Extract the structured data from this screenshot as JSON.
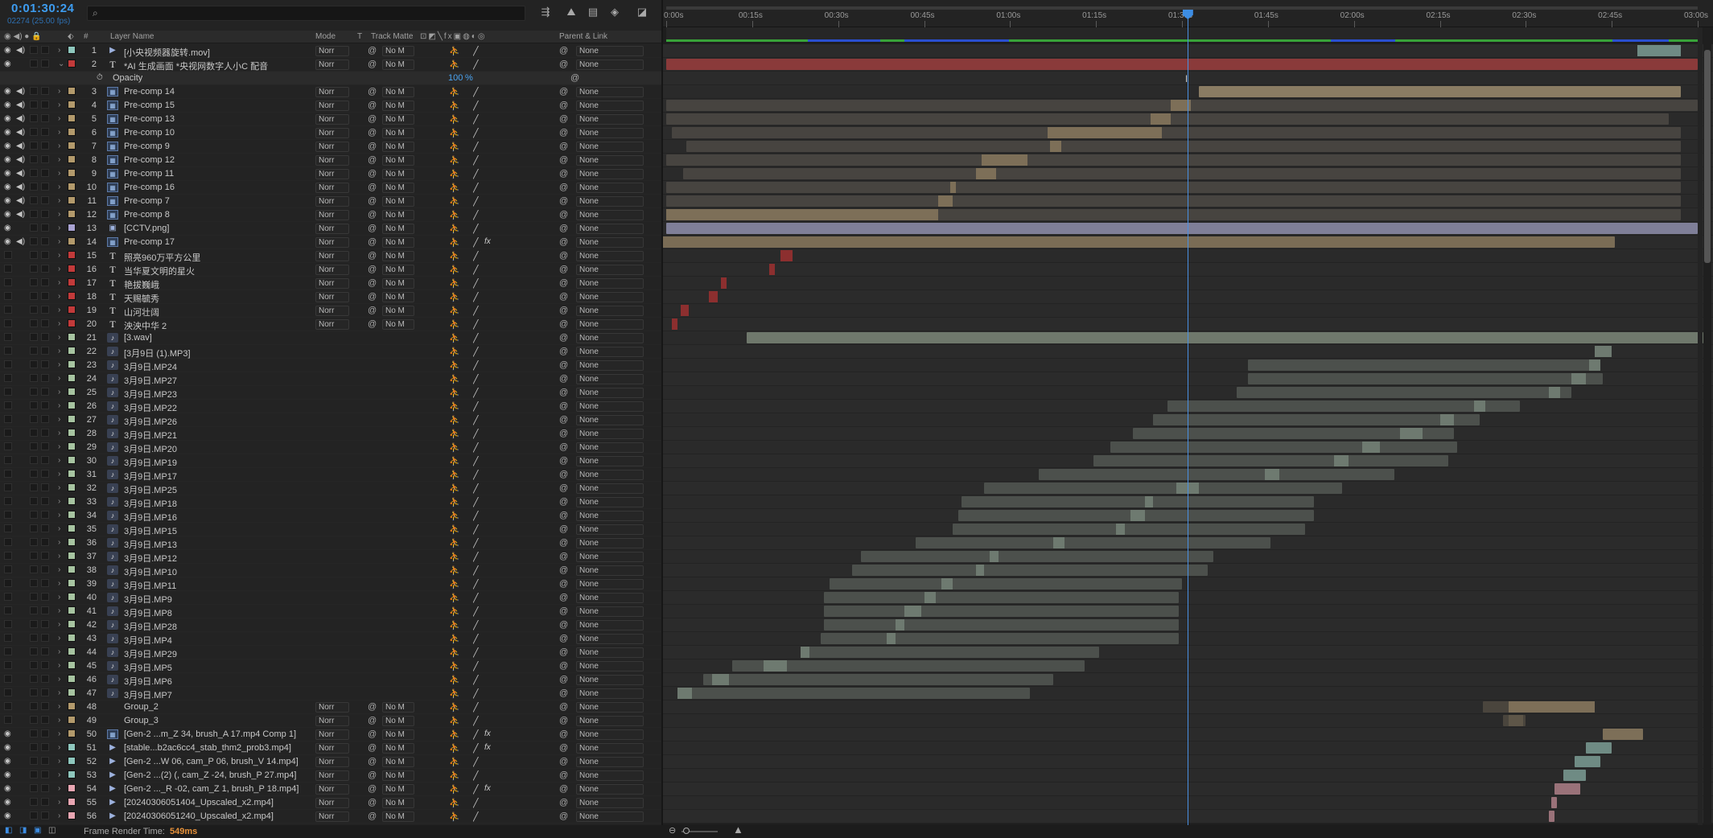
{
  "header": {
    "timecode": "0:01:30:24",
    "fps_info": "02274 (25.00 fps)",
    "search": {
      "placeholder": ""
    }
  },
  "columns": {
    "layer_name": "Layer Name",
    "mode": "Mode",
    "t": "T",
    "track_matte": "Track Matte",
    "parent_link": "Parent & Link",
    "hash": "#"
  },
  "ruler": {
    "ticks": [
      "0:00s",
      "00:15s",
      "00:30s",
      "00:45s",
      "01:00s",
      "01:15s",
      "01:30s",
      "01:45s",
      "02:00s",
      "02:15s",
      "02:30s",
      "02:45s",
      "03:00s"
    ],
    "current_time_s": 90.96,
    "duration_s": 180
  },
  "opacity_row": {
    "label": "Opacity",
    "value": "100",
    "unit": "%"
  },
  "mode_default": "Norr",
  "track_matte_default": "No M",
  "parent_default": "None",
  "layers": [
    {
      "n": "1",
      "name": "[小央视频器旋转.mov]",
      "icon": "footage",
      "color": "#8ec7bd",
      "eye": true,
      "audio": true,
      "fx": false,
      "bars": [
        [
          0.0,
          0.0
        ]
      ],
      "keys": [
        [
          169.4,
          177.0,
          "#6f8b84"
        ]
      ]
    },
    {
      "n": "2",
      "name": "*AI 生成画面 *央视网数字人小C 配音",
      "icon": "text",
      "color": "#c23a3a",
      "eye": true,
      "audio": false,
      "fx": false,
      "bars": [
        [
          0.0,
          180.0,
          "#8a3a3a"
        ]
      ],
      "twirl": true
    },
    {
      "n": "3",
      "name": "Pre-comp 14",
      "icon": "comp",
      "color": "#b39a6c",
      "eye": true,
      "audio": true,
      "fx": false,
      "bars": [
        [
          93.0,
          177.0,
          "#8a7c63"
        ]
      ]
    },
    {
      "n": "4",
      "name": "Pre-comp 15",
      "icon": "comp",
      "color": "#b39a6c",
      "eye": true,
      "audio": true,
      "fx": false,
      "bars": [
        [
          0.0,
          180.0,
          "#474440"
        ]
      ],
      "keys": [
        [
          88.0,
          91.5,
          "#7d6f58"
        ]
      ]
    },
    {
      "n": "5",
      "name": "Pre-comp 13",
      "icon": "comp",
      "color": "#b39a6c",
      "eye": true,
      "audio": true,
      "fx": false,
      "bars": [
        [
          0.0,
          175.0,
          "#474440"
        ]
      ],
      "keys": [
        [
          84.5,
          88.0,
          "#7d6f58"
        ]
      ]
    },
    {
      "n": "6",
      "name": "Pre-comp 10",
      "icon": "comp",
      "color": "#b39a6c",
      "eye": true,
      "audio": true,
      "fx": false,
      "bars": [
        [
          1.0,
          177.0,
          "#474440"
        ]
      ],
      "keys": [
        [
          66.5,
          86.5,
          "#7d6f58"
        ]
      ]
    },
    {
      "n": "7",
      "name": "Pre-comp 9",
      "icon": "comp",
      "color": "#b39a6c",
      "eye": true,
      "audio": true,
      "fx": false,
      "bars": [
        [
          3.5,
          177.0,
          "#474440"
        ]
      ],
      "keys": [
        [
          67.0,
          69.0,
          "#7d6f58"
        ]
      ]
    },
    {
      "n": "8",
      "name": "Pre-comp 12",
      "icon": "comp",
      "color": "#b39a6c",
      "eye": true,
      "audio": true,
      "fx": false,
      "bars": [
        [
          0.0,
          177.0,
          "#474440"
        ]
      ],
      "keys": [
        [
          55.0,
          63.0,
          "#7d6f58"
        ]
      ]
    },
    {
      "n": "9",
      "name": "Pre-comp 11",
      "icon": "comp",
      "color": "#b39a6c",
      "eye": true,
      "audio": true,
      "fx": false,
      "bars": [
        [
          3.0,
          177.0,
          "#474440"
        ]
      ],
      "keys": [
        [
          54.0,
          57.5,
          "#7d6f58"
        ]
      ]
    },
    {
      "n": "10",
      "name": "Pre-comp 16",
      "icon": "comp",
      "color": "#b39a6c",
      "eye": true,
      "audio": true,
      "fx": false,
      "bars": [
        [
          0.0,
          177.0,
          "#474440"
        ]
      ],
      "keys": [
        [
          49.5,
          50.5,
          "#7d6f58"
        ]
      ]
    },
    {
      "n": "11",
      "name": "Pre-comp 7",
      "icon": "comp",
      "color": "#b39a6c",
      "eye": true,
      "audio": true,
      "fx": false,
      "bars": [
        [
          0.0,
          177.0,
          "#474440"
        ]
      ],
      "keys": [
        [
          47.5,
          50.0,
          "#7d6f58"
        ]
      ]
    },
    {
      "n": "12",
      "name": "Pre-comp 8",
      "icon": "comp",
      "color": "#b39a6c",
      "eye": true,
      "audio": true,
      "fx": false,
      "bars": [
        [
          0.0,
          177.0,
          "#474440"
        ]
      ],
      "keys": [
        [
          0.0,
          47.5,
          "#7d6f58"
        ]
      ]
    },
    {
      "n": "13",
      "name": "[CCTV.png]",
      "icon": "image",
      "color": "#a9a3d2",
      "eye": true,
      "audio": false,
      "fx": false,
      "bars": [
        [
          0.0,
          180.0,
          "#7f7f98"
        ]
      ]
    },
    {
      "n": "14",
      "name": "Pre-comp 17",
      "icon": "comp",
      "color": "#b39a6c",
      "eye": true,
      "audio": true,
      "fx": true,
      "bars": [
        [
          -1.0,
          165.5,
          "#7a6c55"
        ]
      ]
    },
    {
      "n": "15",
      "name": "照亮960万平方公里",
      "icon": "text",
      "color": "#c23a3a",
      "eye": false,
      "audio": false,
      "fx": false,
      "bars": [],
      "keys": [
        [
          20.0,
          22.0,
          "#8c2f2f"
        ]
      ]
    },
    {
      "n": "16",
      "name": "当华夏文明的星火",
      "icon": "text",
      "color": "#c23a3a",
      "eye": false,
      "audio": false,
      "fx": false,
      "bars": [],
      "keys": [
        [
          18.0,
          19.0,
          "#8c2f2f"
        ]
      ]
    },
    {
      "n": "17",
      "name": "艳拔巍峨",
      "icon": "text",
      "color": "#c23a3a",
      "eye": false,
      "audio": false,
      "fx": false,
      "bars": [],
      "keys": [
        [
          9.5,
          10.5,
          "#8c2f2f"
        ]
      ]
    },
    {
      "n": "18",
      "name": "天赐毓秀",
      "icon": "text",
      "color": "#c23a3a",
      "eye": false,
      "audio": false,
      "fx": false,
      "bars": [],
      "keys": [
        [
          7.5,
          9.0,
          "#8c2f2f"
        ]
      ]
    },
    {
      "n": "19",
      "name": "山河壮阔",
      "icon": "text",
      "color": "#c23a3a",
      "eye": false,
      "audio": false,
      "fx": false,
      "bars": [],
      "keys": [
        [
          2.5,
          4.0,
          "#8c2f2f"
        ]
      ]
    },
    {
      "n": "20",
      "name": "泱泱中华 2",
      "icon": "text",
      "color": "#c23a3a",
      "eye": false,
      "audio": false,
      "fx": false,
      "bars": [],
      "keys": [
        [
          1.0,
          2.0,
          "#8c2f2f"
        ]
      ]
    },
    {
      "n": "21",
      "name": "[3.wav]",
      "icon": "audio",
      "color": "#a7c4a1",
      "eye": false,
      "audio": false,
      "fx": false,
      "bars": [
        [
          14.0,
          181.0,
          "#6f786c"
        ]
      ]
    },
    {
      "n": "22",
      "name": "[3月9日 (1).MP3]",
      "icon": "audio",
      "color": "#a7c4a1",
      "eye": false,
      "audio": false,
      "fx": false,
      "bars": [],
      "keys": [
        [
          162.0,
          165.0,
          "#6e7a70"
        ]
      ]
    },
    {
      "n": "23",
      "name": "3月9日.MP24",
      "icon": "audio",
      "color": "#a7c4a1",
      "eye": false,
      "audio": false,
      "fx": false,
      "bars": [
        [
          101.5,
          162.5,
          "#4c504c"
        ]
      ],
      "keys": [
        [
          161.0,
          163.0,
          "#6e7a70"
        ]
      ]
    },
    {
      "n": "24",
      "name": "3月9日.MP27",
      "icon": "audio",
      "color": "#a7c4a1",
      "eye": false,
      "audio": false,
      "fx": false,
      "bars": [
        [
          101.5,
          163.5,
          "#4c504c"
        ]
      ],
      "keys": [
        [
          158.0,
          160.5,
          "#6e7a70"
        ]
      ]
    },
    {
      "n": "25",
      "name": "3月9日.MP23",
      "icon": "audio",
      "color": "#a7c4a1",
      "eye": false,
      "audio": false,
      "fx": false,
      "bars": [
        [
          99.5,
          158.0,
          "#4c504c"
        ]
      ],
      "keys": [
        [
          154.0,
          156.0,
          "#6e7a70"
        ]
      ]
    },
    {
      "n": "26",
      "name": "3月9日.MP22",
      "icon": "audio",
      "color": "#a7c4a1",
      "eye": false,
      "audio": false,
      "fx": false,
      "bars": [
        [
          87.5,
          149.0,
          "#4c504c"
        ]
      ],
      "keys": [
        [
          141.0,
          143.0,
          "#6e7a70"
        ]
      ]
    },
    {
      "n": "27",
      "name": "3月9日.MP26",
      "icon": "audio",
      "color": "#a7c4a1",
      "eye": false,
      "audio": false,
      "fx": false,
      "bars": [
        [
          85.0,
          142.0,
          "#4c504c"
        ]
      ],
      "keys": [
        [
          135.0,
          137.5,
          "#6e7a70"
        ]
      ]
    },
    {
      "n": "28",
      "name": "3月9日.MP21",
      "icon": "audio",
      "color": "#a7c4a1",
      "eye": false,
      "audio": false,
      "fx": false,
      "bars": [
        [
          81.5,
          137.5,
          "#4c504c"
        ]
      ],
      "keys": [
        [
          128.0,
          132.0,
          "#6e7a70"
        ]
      ]
    },
    {
      "n": "29",
      "name": "3月9日.MP20",
      "icon": "audio",
      "color": "#a7c4a1",
      "eye": false,
      "audio": false,
      "fx": false,
      "bars": [
        [
          77.5,
          138.0,
          "#4c504c"
        ]
      ],
      "keys": [
        [
          121.5,
          124.5,
          "#6e7a70"
        ]
      ]
    },
    {
      "n": "30",
      "name": "3月9日.MP19",
      "icon": "audio",
      "color": "#a7c4a1",
      "eye": false,
      "audio": false,
      "fx": false,
      "bars": [
        [
          74.5,
          136.5,
          "#4c504c"
        ]
      ],
      "keys": [
        [
          116.5,
          119.0,
          "#6e7a70"
        ]
      ]
    },
    {
      "n": "31",
      "name": "3月9日.MP17",
      "icon": "audio",
      "color": "#a7c4a1",
      "eye": false,
      "audio": false,
      "fx": false,
      "bars": [
        [
          65.0,
          127.0,
          "#4c504c"
        ]
      ],
      "keys": [
        [
          104.5,
          107.0,
          "#6e7a70"
        ]
      ]
    },
    {
      "n": "32",
      "name": "3月9日.MP25",
      "icon": "audio",
      "color": "#a7c4a1",
      "eye": false,
      "audio": false,
      "fx": false,
      "bars": [
        [
          55.5,
          118.0,
          "#4c504c"
        ]
      ],
      "keys": [
        [
          89.0,
          93.0,
          "#6e7a70"
        ]
      ]
    },
    {
      "n": "33",
      "name": "3月9日.MP18",
      "icon": "audio",
      "color": "#a7c4a1",
      "eye": false,
      "audio": false,
      "fx": false,
      "bars": [
        [
          51.5,
          113.0,
          "#4c504c"
        ]
      ],
      "keys": [
        [
          83.5,
          85.0,
          "#6e7a70"
        ]
      ]
    },
    {
      "n": "34",
      "name": "3月9日.MP16",
      "icon": "audio",
      "color": "#a7c4a1",
      "eye": false,
      "audio": false,
      "fx": false,
      "bars": [
        [
          51.0,
          113.0,
          "#4c504c"
        ]
      ],
      "keys": [
        [
          81.0,
          83.5,
          "#6e7a70"
        ]
      ]
    },
    {
      "n": "35",
      "name": "3月9日.MP15",
      "icon": "audio",
      "color": "#a7c4a1",
      "eye": false,
      "audio": false,
      "fx": false,
      "bars": [
        [
          50.0,
          111.5,
          "#4c504c"
        ]
      ],
      "keys": [
        [
          78.5,
          80.0,
          "#6e7a70"
        ]
      ]
    },
    {
      "n": "36",
      "name": "3月9日.MP13",
      "icon": "audio",
      "color": "#a7c4a1",
      "eye": false,
      "audio": false,
      "fx": false,
      "bars": [
        [
          43.5,
          105.5,
          "#4c504c"
        ]
      ],
      "keys": [
        [
          67.5,
          69.5,
          "#6e7a70"
        ]
      ]
    },
    {
      "n": "37",
      "name": "3月9日.MP12",
      "icon": "audio",
      "color": "#a7c4a1",
      "eye": false,
      "audio": false,
      "fx": false,
      "bars": [
        [
          34.0,
          95.5,
          "#4c504c"
        ]
      ],
      "keys": [
        [
          56.5,
          58.0,
          "#6e7a70"
        ]
      ]
    },
    {
      "n": "38",
      "name": "3月9日.MP10",
      "icon": "audio",
      "color": "#a7c4a1",
      "eye": false,
      "audio": false,
      "fx": false,
      "bars": [
        [
          32.5,
          94.5,
          "#4c504c"
        ]
      ],
      "keys": [
        [
          54.0,
          55.5,
          "#6e7a70"
        ]
      ]
    },
    {
      "n": "39",
      "name": "3月9日.MP11",
      "icon": "audio",
      "color": "#a7c4a1",
      "eye": false,
      "audio": false,
      "fx": false,
      "bars": [
        [
          28.5,
          90.0,
          "#4c504c"
        ]
      ],
      "keys": [
        [
          48.0,
          50.0,
          "#6e7a70"
        ]
      ]
    },
    {
      "n": "40",
      "name": "3月9日.MP9",
      "icon": "audio",
      "color": "#a7c4a1",
      "eye": false,
      "audio": false,
      "fx": false,
      "bars": [
        [
          27.5,
          89.5,
          "#4c504c"
        ]
      ],
      "keys": [
        [
          45.0,
          47.0,
          "#6e7a70"
        ]
      ]
    },
    {
      "n": "41",
      "name": "3月9日.MP8",
      "icon": "audio",
      "color": "#a7c4a1",
      "eye": false,
      "audio": false,
      "fx": false,
      "bars": [
        [
          27.5,
          89.5,
          "#4c504c"
        ]
      ],
      "keys": [
        [
          41.5,
          44.5,
          "#6e7a70"
        ]
      ]
    },
    {
      "n": "42",
      "name": "3月9日.MP28",
      "icon": "audio",
      "color": "#a7c4a1",
      "eye": false,
      "audio": false,
      "fx": false,
      "bars": [
        [
          27.5,
          89.5,
          "#4c504c"
        ]
      ],
      "keys": [
        [
          40.0,
          41.5,
          "#6e7a70"
        ]
      ]
    },
    {
      "n": "43",
      "name": "3月9日.MP4",
      "icon": "audio",
      "color": "#a7c4a1",
      "eye": false,
      "audio": false,
      "fx": false,
      "bars": [
        [
          27.0,
          89.5,
          "#4c504c"
        ]
      ],
      "keys": [
        [
          38.5,
          40.0,
          "#6e7a70"
        ]
      ]
    },
    {
      "n": "44",
      "name": "3月9日.MP29",
      "icon": "audio",
      "color": "#a7c4a1",
      "eye": false,
      "audio": false,
      "fx": false,
      "bars": [
        [
          24.0,
          75.5,
          "#4c504c"
        ]
      ],
      "keys": [
        [
          23.5,
          25.0,
          "#6e7a70"
        ]
      ]
    },
    {
      "n": "45",
      "name": "3月9日.MP5",
      "icon": "audio",
      "color": "#a7c4a1",
      "eye": false,
      "audio": false,
      "fx": false,
      "bars": [
        [
          11.5,
          73.0,
          "#4c504c"
        ]
      ],
      "keys": [
        [
          17.0,
          21.0,
          "#6e7a70"
        ]
      ]
    },
    {
      "n": "46",
      "name": "3月9日.MP6",
      "icon": "audio",
      "color": "#a7c4a1",
      "eye": false,
      "audio": false,
      "fx": false,
      "bars": [
        [
          6.5,
          67.5,
          "#4c504c"
        ]
      ],
      "keys": [
        [
          8.0,
          11.0,
          "#6e7a70"
        ]
      ]
    },
    {
      "n": "47",
      "name": "3月9日.MP7",
      "icon": "audio",
      "color": "#a7c4a1",
      "eye": false,
      "audio": false,
      "fx": false,
      "bars": [
        [
          2.0,
          63.5,
          "#4c504c"
        ]
      ],
      "keys": [
        [
          2.0,
          4.5,
          "#6e7a70"
        ]
      ]
    },
    {
      "n": "48",
      "name": "Group_2",
      "icon": "none",
      "color": "#b39a6c",
      "eye": false,
      "audio": false,
      "fx": false,
      "bars": [
        [
          142.5,
          162.0,
          "#4a453d"
        ]
      ],
      "keys": [
        [
          147.0,
          162.0,
          "#7d6f58"
        ]
      ]
    },
    {
      "n": "49",
      "name": "Group_3",
      "icon": "none",
      "color": "#b39a6c",
      "eye": false,
      "audio": false,
      "fx": false,
      "bars": [
        [
          146.0,
          150.0,
          "#4a453d"
        ]
      ],
      "keys": [
        [
          147.0,
          149.5,
          "#5e5648"
        ]
      ]
    },
    {
      "n": "50",
      "name": "[Gen-2 ...m_Z 34, brush_A 17.mp4 Comp 1]",
      "icon": "comp",
      "color": "#b39a6c",
      "eye": true,
      "audio": false,
      "fx": true,
      "bars": [
        [
          163.5,
          170.5,
          "#7d6f58"
        ]
      ]
    },
    {
      "n": "51",
      "name": "[stable...b2ac6cc4_stab_thm2_prob3.mp4]",
      "icon": "footage",
      "color": "#8ec7bd",
      "eye": true,
      "audio": false,
      "fx": true,
      "bars": [
        [
          160.5,
          165.0,
          "#6f8b84"
        ]
      ]
    },
    {
      "n": "52",
      "name": "[Gen-2 ...W 06, cam_P 06, brush_V 14.mp4]",
      "icon": "footage",
      "color": "#8ec7bd",
      "eye": true,
      "audio": false,
      "fx": false,
      "bars": [
        [
          158.5,
          163.0,
          "#6f8b84"
        ]
      ]
    },
    {
      "n": "53",
      "name": "[Gen-2 ...(2) (, cam_Z -24, brush_P 27.mp4]",
      "icon": "footage",
      "color": "#8ec7bd",
      "eye": true,
      "audio": false,
      "fx": false,
      "bars": [
        [
          156.5,
          160.5,
          "#6f8b84"
        ]
      ]
    },
    {
      "n": "54",
      "name": "[Gen-2 ..._R -02, cam_Z 1, brush_P 18.mp4]",
      "icon": "footage",
      "color": "#e8a6b2",
      "eye": true,
      "audio": false,
      "fx": true,
      "bars": [
        [
          155.0,
          159.5,
          "#9a7279"
        ]
      ]
    },
    {
      "n": "55",
      "name": "[20240306051404_Upscaled_x2.mp4]",
      "icon": "footage",
      "color": "#e8a6b2",
      "eye": true,
      "audio": false,
      "fx": false,
      "bars": [
        [
          154.5,
          155.5,
          "#9a7279"
        ]
      ]
    },
    {
      "n": "56",
      "name": "[20240306051240_Upscaled_x2.mp4]",
      "icon": "footage",
      "color": "#e8a6b2",
      "eye": true,
      "audio": false,
      "fx": false,
      "bars": [
        [
          154.0,
          155.0,
          "#9a7279"
        ]
      ]
    }
  ],
  "statusbar": {
    "frame_render_label": "Frame Render Time:",
    "frame_render_value": "549ms"
  }
}
